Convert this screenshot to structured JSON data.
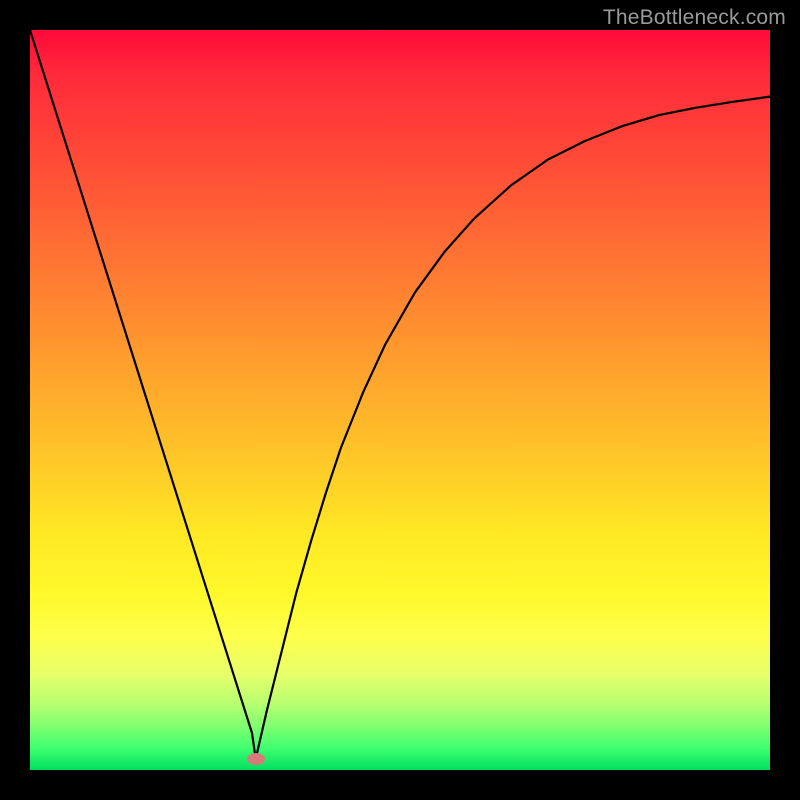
{
  "watermark": "TheBottleneck.com",
  "marker": {
    "x_frac": 0.305,
    "y_frac": 0.985
  },
  "chart_data": {
    "type": "line",
    "title": "",
    "xlabel": "",
    "ylabel": "",
    "xlim": [
      0,
      1
    ],
    "ylim": [
      0,
      1
    ],
    "series": [
      {
        "name": "left-branch",
        "x": [
          0.0,
          0.03,
          0.06,
          0.09,
          0.12,
          0.15,
          0.18,
          0.21,
          0.24,
          0.27,
          0.3,
          0.305
        ],
        "y": [
          1.0,
          0.905,
          0.81,
          0.715,
          0.62,
          0.525,
          0.43,
          0.335,
          0.24,
          0.145,
          0.05,
          0.015
        ]
      },
      {
        "name": "right-branch",
        "x": [
          0.305,
          0.32,
          0.34,
          0.36,
          0.38,
          0.4,
          0.42,
          0.45,
          0.48,
          0.52,
          0.56,
          0.6,
          0.65,
          0.7,
          0.75,
          0.8,
          0.85,
          0.9,
          0.95,
          1.0
        ],
        "y": [
          0.015,
          0.08,
          0.16,
          0.24,
          0.31,
          0.375,
          0.435,
          0.51,
          0.575,
          0.645,
          0.7,
          0.745,
          0.79,
          0.825,
          0.85,
          0.87,
          0.885,
          0.895,
          0.903,
          0.91
        ]
      }
    ],
    "marker": {
      "x": 0.305,
      "y": 0.015
    }
  }
}
